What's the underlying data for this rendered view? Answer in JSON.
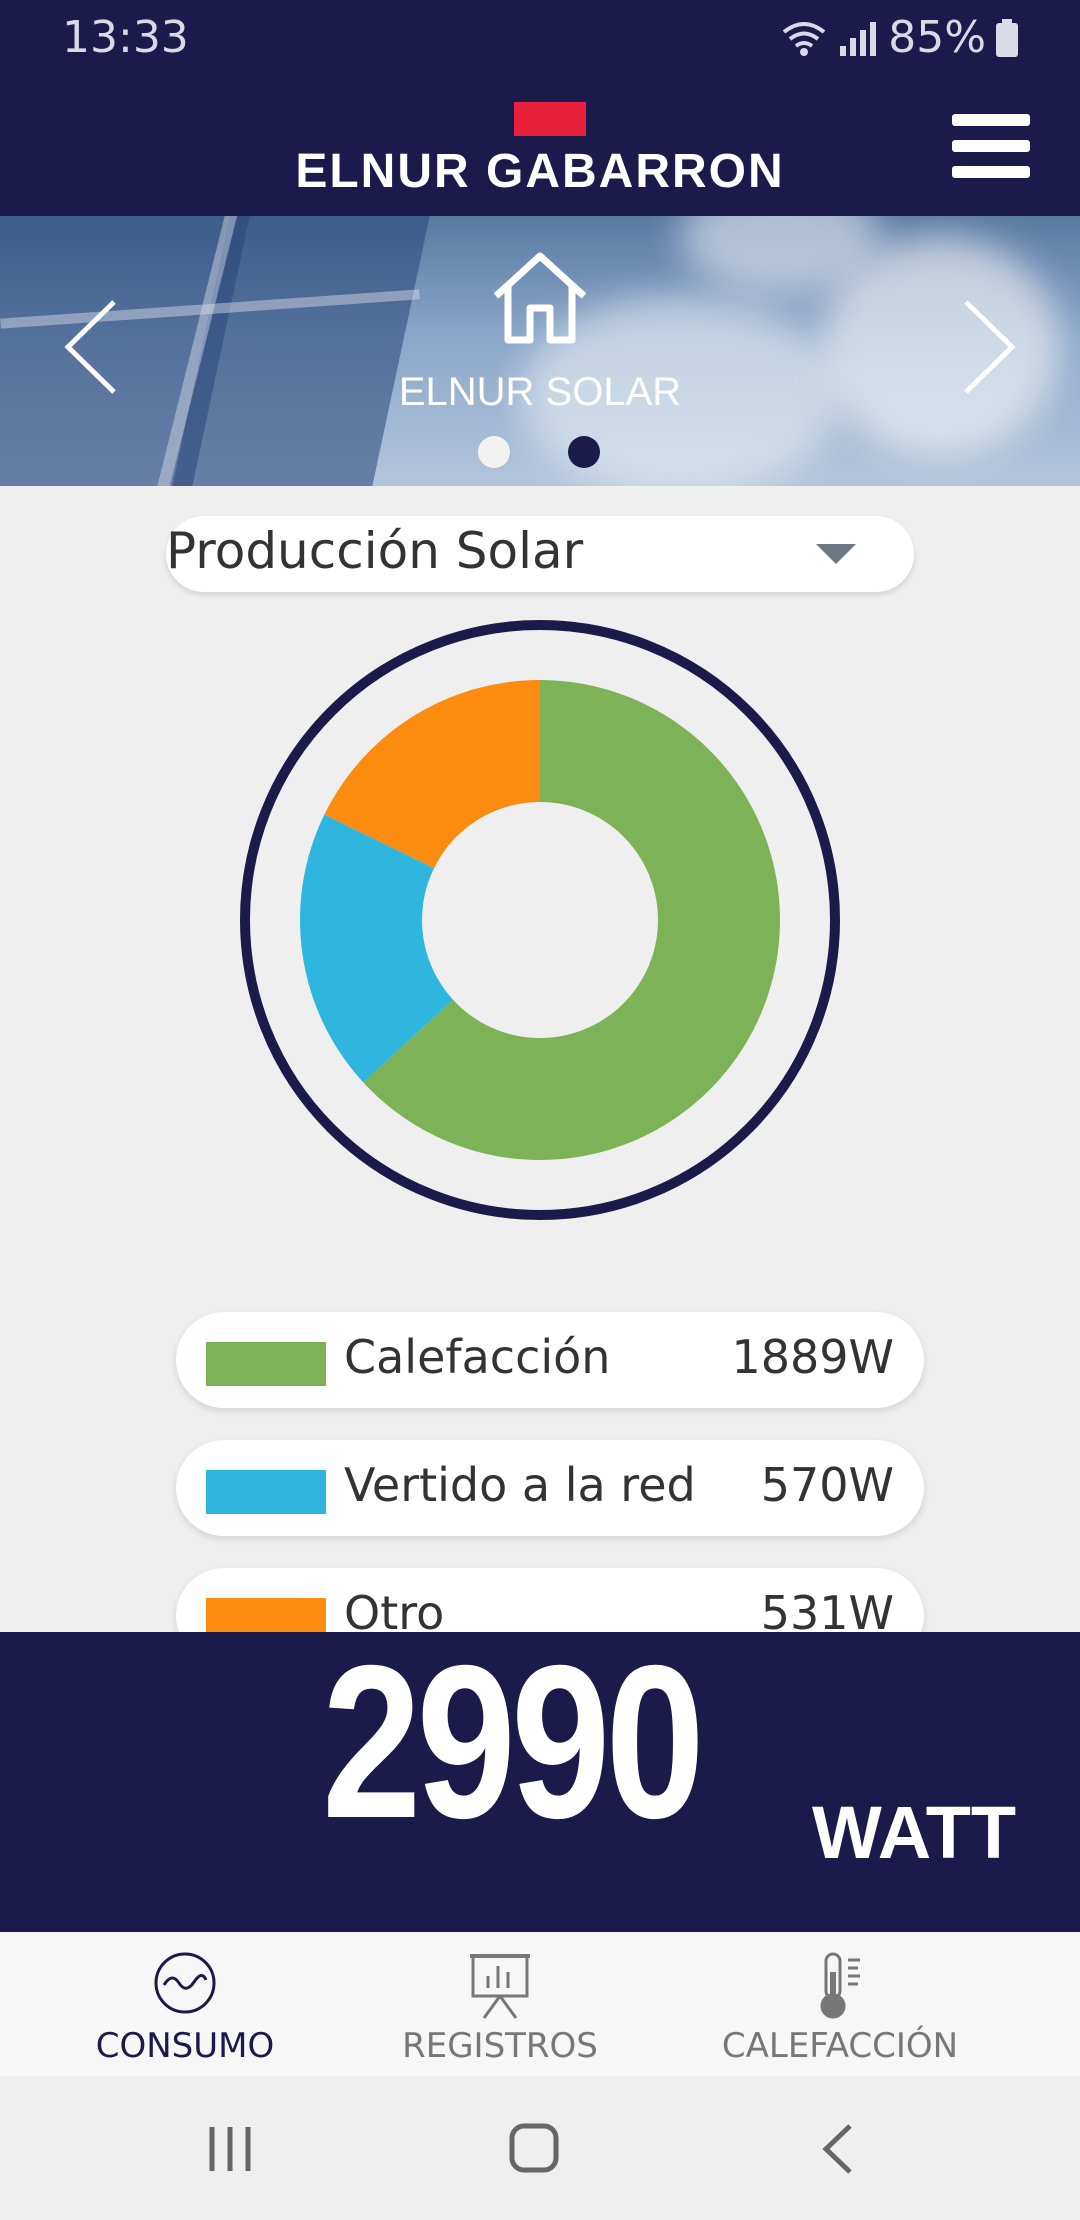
{
  "status_bar": {
    "time": "13:33",
    "battery": "85%"
  },
  "header": {
    "brand": "ELNUR GABARRON",
    "menu_icon": "hamburger-menu-icon"
  },
  "banner": {
    "title": "ELNUR SOLAR",
    "icon": "home-icon",
    "page_dots": 2,
    "active_dot": 2
  },
  "dropdown": {
    "selected": "Producción Solar"
  },
  "chart_data": {
    "type": "pie",
    "categories": [
      "Calefacción",
      "Vertido a la red",
      "Otro"
    ],
    "values": [
      1889,
      570,
      531
    ],
    "colors": [
      "#7db356",
      "#2fb6de",
      "#fb8c10"
    ],
    "title": ""
  },
  "legend": {
    "items": [
      {
        "label": "Calefacción",
        "value": "1889W",
        "color": "#7db356"
      },
      {
        "label": "Vertido a la red",
        "value": "570W",
        "color": "#2fb6de"
      },
      {
        "label": "Otro",
        "value": "531W",
        "color": "#fb8c10"
      }
    ]
  },
  "total": {
    "value": "2990",
    "unit": "WATT"
  },
  "bottom_nav": {
    "items": [
      {
        "label": "CONSUMO",
        "icon": "wave-icon",
        "active": true
      },
      {
        "label": "REGISTROS",
        "icon": "chart-board-icon",
        "active": false
      },
      {
        "label": "CALEFACCIÓN",
        "icon": "thermometer-icon",
        "active": false
      }
    ]
  },
  "colors": {
    "navy": "#1c1a4a",
    "brand_red": "#e8203a"
  }
}
